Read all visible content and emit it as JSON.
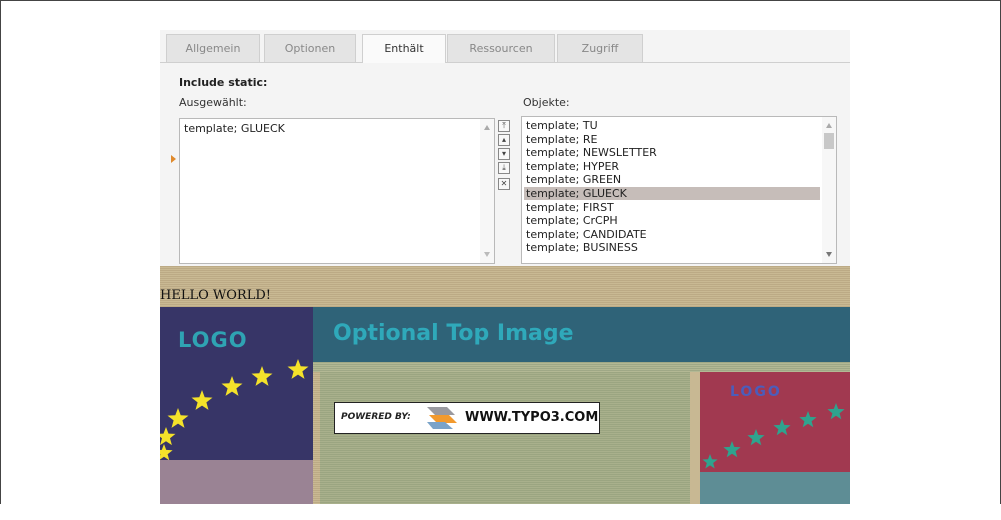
{
  "tabs": [
    {
      "label": "Allgemein",
      "active": false
    },
    {
      "label": "Optionen",
      "active": false
    },
    {
      "label": "Enthält",
      "active": true
    },
    {
      "label": "Ressourcen",
      "active": false
    },
    {
      "label": "Zugriff",
      "active": false
    }
  ],
  "include_static": {
    "title": "Include static:",
    "selected_label": "Ausgewählt:",
    "objects_label": "Objekte:",
    "selected_items": [
      "template; GLUECK"
    ],
    "object_items": [
      "template; TU",
      "template; RE",
      "template; NEWSLETTER",
      "template; HYPER",
      "template; GREEN",
      "template; GLUECK",
      "template; FIRST",
      "template; CrCPH",
      "template; CANDIDATE",
      "template; BUSINESS"
    ],
    "highlighted_index": 5,
    "controls": [
      {
        "icon": "move-top-icon",
        "glyph": "⤒"
      },
      {
        "icon": "move-up-icon",
        "glyph": "▴"
      },
      {
        "icon": "move-down-icon",
        "glyph": "▾"
      },
      {
        "icon": "move-bottom-icon",
        "glyph": "⤓"
      },
      {
        "icon": "remove-icon",
        "glyph": "✕"
      }
    ]
  },
  "preview": {
    "hello": "HELLO WORLD!",
    "logo_left": "LOGO",
    "top_image_text": "Optional Top Image",
    "powered_label": "POWERED BY:",
    "powered_url": "WWW.TYPO3.COM",
    "logo_right": "LOGO",
    "colors": {
      "left_panel": "#373567",
      "banner": "#2f6378",
      "logo_text": "#2fa3b3",
      "right_panel": "#a13950",
      "star_yellow": "#f4e22a",
      "star_teal": "#2fa38e"
    }
  }
}
